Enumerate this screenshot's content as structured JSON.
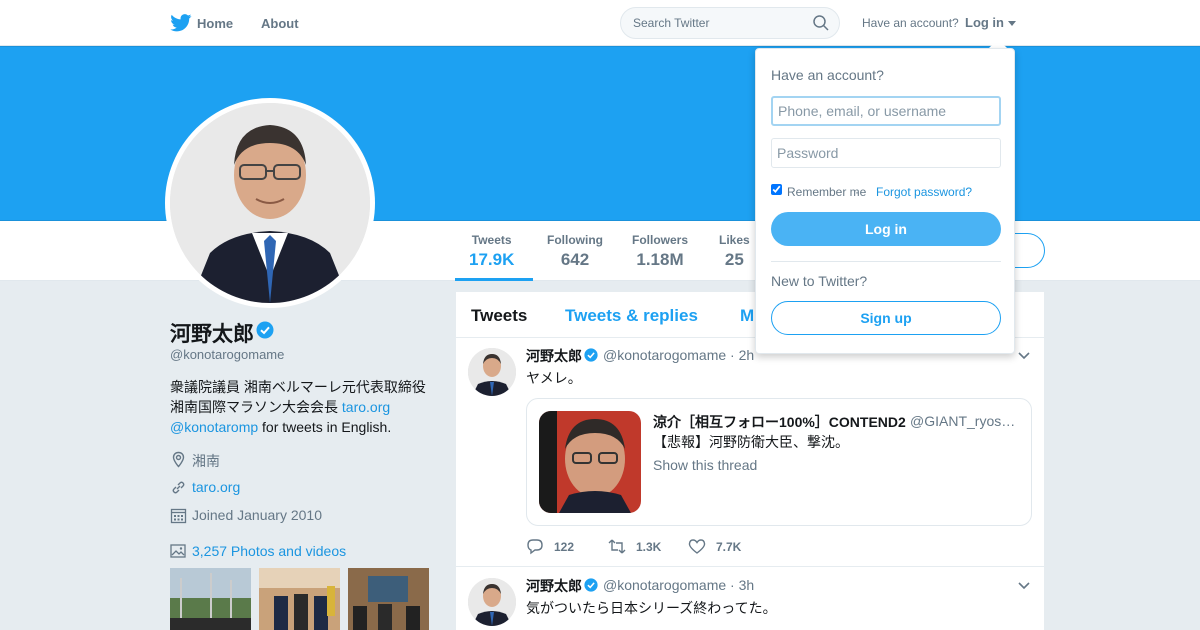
{
  "nav": {
    "home_label": "Home",
    "about_label": "About",
    "search_placeholder": "Search Twitter",
    "have_account": "Have an account?",
    "login_label": "Log in"
  },
  "profile": {
    "name": "河野太郎",
    "handle": "@konotarogomame",
    "bio_line1": "衆議院議員 湘南ベルマーレ元代表取締役",
    "bio_line2": "湘南国際マラソン大会会長 ",
    "bio_link1": "taro.org",
    "bio_link2": "@konotaromp",
    "bio_line3": " for tweets in English.",
    "location": "湘南",
    "website": "taro.org",
    "joined": "Joined January 2010",
    "photos_label": "3,257 Photos and videos"
  },
  "stats": [
    {
      "label": "Tweets",
      "value": "17.9K"
    },
    {
      "label": "Following",
      "value": "642"
    },
    {
      "label": "Followers",
      "value": "1.18M"
    },
    {
      "label": "Likes",
      "value": "25"
    }
  ],
  "tabs": [
    "Tweets",
    "Tweets & replies",
    "M"
  ],
  "tweets": [
    {
      "name": "河野太郎",
      "handle": "@konotarogomame · 2h",
      "text": "ヤメレ。",
      "quote": {
        "name": "涼介［相互フォロー100%］CONTEND2",
        "handle": "@GIANT_ryosuke",
        "text": "【悲報】河野防衛大臣、撃沈。",
        "thread": "Show this thread"
      },
      "replies": "122",
      "retweets": "1.3K",
      "likes": "7.7K"
    },
    {
      "name": "河野太郎",
      "handle": "@konotarogomame · 3h",
      "text": "気がついたら日本シリーズ終わってた。"
    }
  ],
  "login_dropdown": {
    "title": "Have an account?",
    "username_placeholder": "Phone, email, or username",
    "password_placeholder": "Password",
    "remember_label": "Remember me",
    "separator": " · ",
    "forgot_label": "Forgot password?",
    "login_button": "Log in",
    "new_label": "New to Twitter?",
    "signup_button": "Sign up"
  },
  "colors": {
    "brand": "#1da1f2",
    "banner": "#1da1f2",
    "background": "#e6ecf0",
    "link": "#1b95e0"
  }
}
